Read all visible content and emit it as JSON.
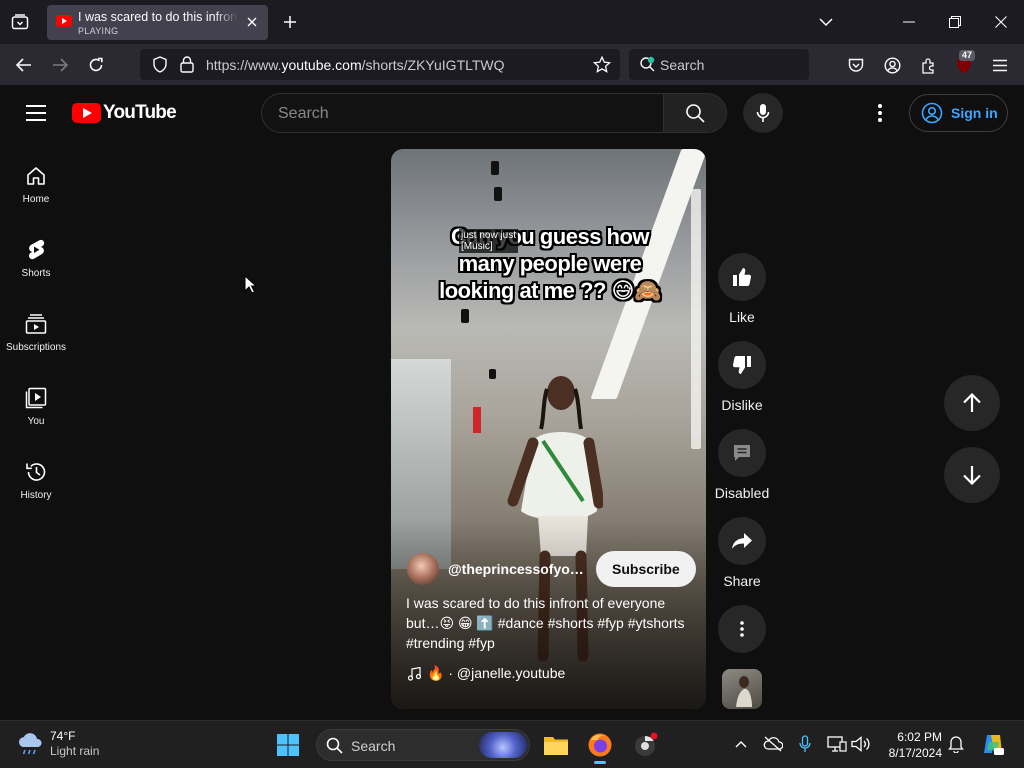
{
  "browser": {
    "tab": {
      "title": "I was scared to do this infront of everyone",
      "status": "PLAYING"
    },
    "url": {
      "prefix": "https://www.",
      "host": "youtube.com",
      "path": "/shorts/ZKYuIGTLTWQ"
    },
    "search_placeholder": "Search",
    "extension_badge": "47"
  },
  "youtube": {
    "logo_text": "YouTube",
    "search_placeholder": "Search",
    "sign_in_label": "Sign in",
    "sidebar": [
      {
        "label": "Home",
        "icon": "home-icon"
      },
      {
        "label": "Shorts",
        "icon": "shorts-icon"
      },
      {
        "label": "Subscriptions",
        "icon": "subscriptions-icon"
      },
      {
        "label": "You",
        "icon": "you-icon"
      },
      {
        "label": "History",
        "icon": "history-icon"
      }
    ],
    "short": {
      "overlay_text": "Can you guess how many people were looking at me ?? 😅🙈",
      "caption_line1": "just now just",
      "caption_line2": "[Music]",
      "channel": "@theprincessofyoutube",
      "subscribe_label": "Subscribe",
      "description": "I was scared to do this infront of everyone but…😝 😁 ⬆️ #dance #shorts #fyp #ytshorts #trending #fyp",
      "sound": "🔥 · @janelle.youtube"
    },
    "actions": {
      "like": "Like",
      "dislike": "Dislike",
      "comments": "Disabled",
      "share": "Share"
    }
  },
  "taskbar": {
    "weather_temp": "74°F",
    "weather_desc": "Light rain",
    "search_placeholder": "Search",
    "time": "6:02 PM",
    "date": "8/17/2024"
  },
  "colors": {
    "accent_red": "#ff0000",
    "link_blue": "#3ea6ff",
    "page_bg": "#0f0f0f"
  }
}
